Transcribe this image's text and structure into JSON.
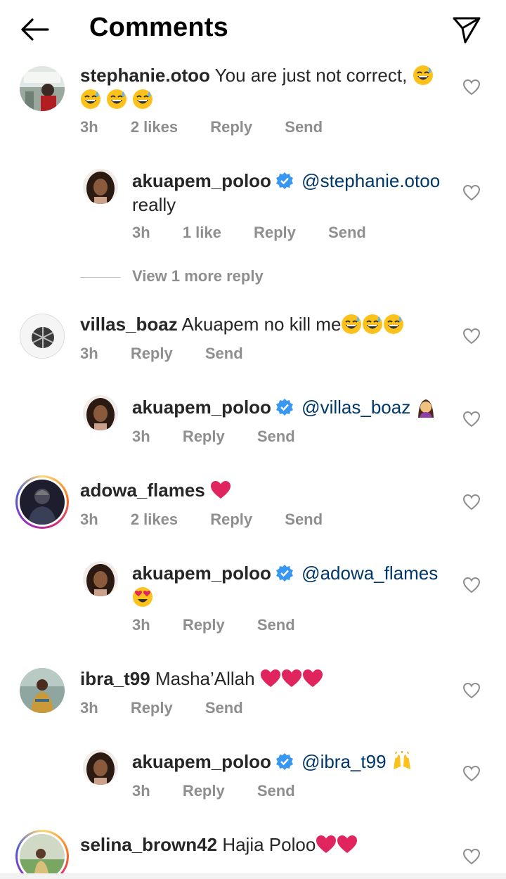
{
  "header": {
    "title": "Comments",
    "back_icon": "arrow-left-icon",
    "send_icon": "paper-plane-icon"
  },
  "colors": {
    "mention": "#00376b",
    "meta": "#8e8e8e",
    "verified": "#3897f0",
    "heart_emoji": "#e0245e"
  },
  "comments": [
    {
      "user": "stephanie.otoo",
      "text": "You are just not correct,",
      "emoji": [
        "grin-sweat",
        "grin-sweat",
        "grin-sweat",
        "grin-sweat"
      ],
      "time": "3h",
      "likes": "2 likes",
      "reply": "Reply",
      "send": "Send"
    },
    {
      "user": "akuapem_poloo",
      "verified": true,
      "mention": "@stephanie.otoo",
      "text": "really",
      "time": "3h",
      "likes": "1 like",
      "reply": "Reply",
      "send": "Send"
    },
    {
      "view_more": "View 1 more reply"
    },
    {
      "user": "villas_boaz",
      "text": "Akuapem no kill me",
      "emoji": [
        "grin-sweat",
        "grin-sweat",
        "grin-sweat"
      ],
      "time": "3h",
      "reply": "Reply",
      "send": "Send"
    },
    {
      "user": "akuapem_poloo",
      "verified": true,
      "mention": "@villas_boaz",
      "emoji": [
        "facepalm"
      ],
      "time": "3h",
      "reply": "Reply",
      "send": "Send"
    },
    {
      "user": "adowa_flames",
      "emoji": [
        "red-heart"
      ],
      "time": "3h",
      "likes": "2 likes",
      "reply": "Reply",
      "send": "Send"
    },
    {
      "user": "akuapem_poloo",
      "verified": true,
      "mention": "@adowa_flames",
      "emoji": [
        "heart-eyes"
      ],
      "time": "3h",
      "reply": "Reply",
      "send": "Send"
    },
    {
      "user": "ibra_t99",
      "text": "Masha’Allah",
      "emoji": [
        "red-heart",
        "red-heart",
        "red-heart"
      ],
      "time": "3h",
      "reply": "Reply",
      "send": "Send"
    },
    {
      "user": "akuapem_poloo",
      "verified": true,
      "mention": "@ibra_t99",
      "emoji": [
        "raising-hands"
      ],
      "time": "3h",
      "reply": "Reply",
      "send": "Send"
    },
    {
      "user": "selina_brown42",
      "text": "Hajia Poloo",
      "emoji": [
        "red-heart",
        "red-heart"
      ]
    }
  ]
}
